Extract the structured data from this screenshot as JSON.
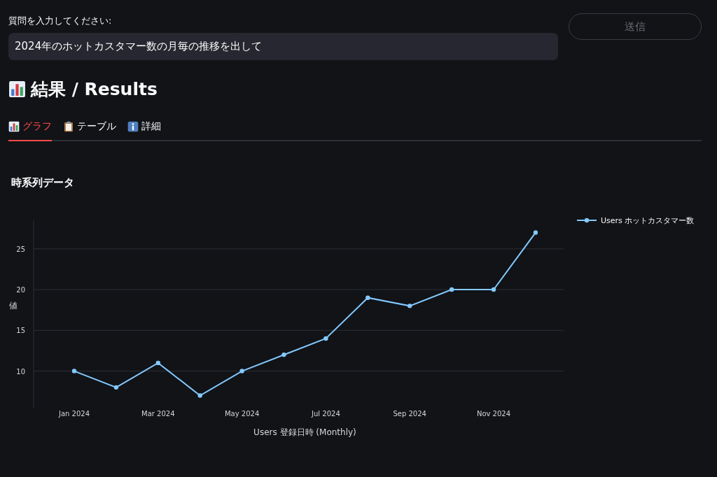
{
  "query": {
    "label": "質問を入力してください:",
    "value": "2024年のホットカスタマー数の月毎の推移を出して"
  },
  "submit_button": {
    "label": "送信",
    "disabled": true
  },
  "heading": "結果 / Results",
  "tabs": [
    {
      "label": "グラフ",
      "kind": "chart",
      "selected": true
    },
    {
      "label": "テーブル",
      "kind": "clipboard",
      "selected": false
    },
    {
      "label": "詳細",
      "kind": "info",
      "selected": false
    }
  ],
  "chart": {
    "title": "時系列データ",
    "chart_data": {
      "type": "line",
      "xlabel": "Users 登録日時 (Monthly)",
      "ylabel": "値",
      "categories": [
        "Jan 2024",
        null,
        "Mar 2024",
        null,
        "May 2024",
        null,
        "Jul 2024",
        null,
        "Sep 2024",
        null,
        "Nov 2024",
        null
      ],
      "grid": true,
      "series": [
        {
          "name": "Users ホットカスタマー数",
          "color": "#83c9ff",
          "marker": "circle",
          "values": [
            10,
            8,
            11,
            7,
            10,
            12,
            14,
            19,
            18,
            20,
            20,
            27
          ]
        }
      ],
      "ylim": [
        5.5,
        28.5
      ],
      "yticks": [
        10,
        15,
        20,
        25
      ]
    }
  }
}
